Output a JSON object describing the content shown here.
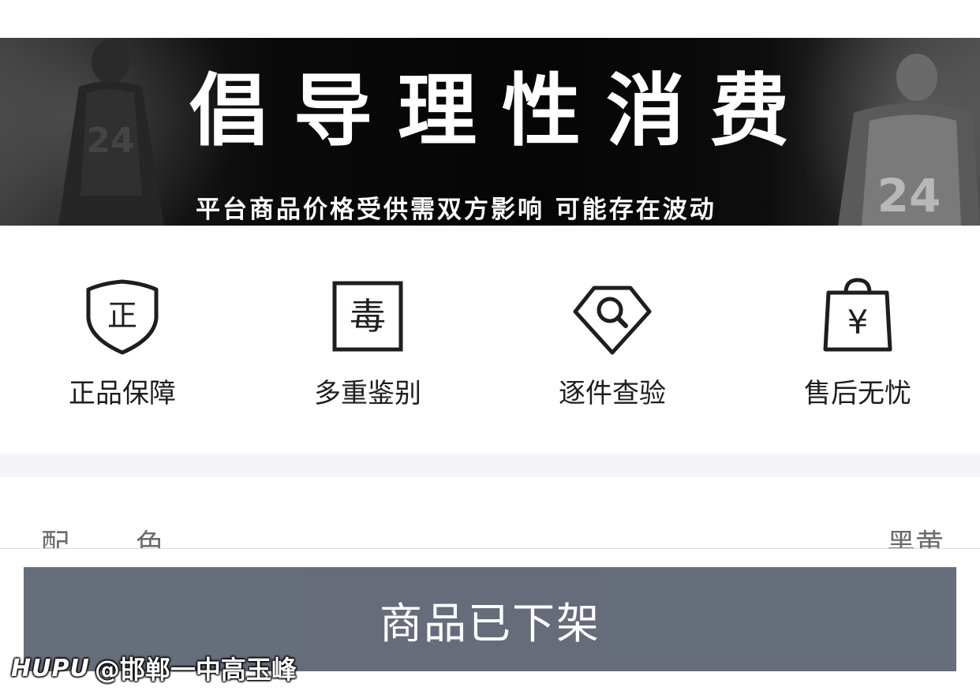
{
  "banner": {
    "headline": "倡导理性消费",
    "subline": "平台商品价格受供需双方影响  可能存在波动"
  },
  "features": [
    {
      "icon": "shield-zheng-icon",
      "glyph": "正",
      "label": "正品保障"
    },
    {
      "icon": "du-logo-icon",
      "glyph": "毒",
      "label": "多重鉴别"
    },
    {
      "icon": "diamond-magnifier-icon",
      "label": "逐件查验"
    },
    {
      "icon": "shopping-bag-yen-icon",
      "glyph": "¥",
      "label": "售后无忧"
    }
  ],
  "spec": {
    "label": "配色",
    "value": "黑黄"
  },
  "action": {
    "offshelf_label": "商品已下架"
  },
  "watermark": {
    "brand": "HUPU",
    "handle": "@邯郸一中高玉峰"
  }
}
